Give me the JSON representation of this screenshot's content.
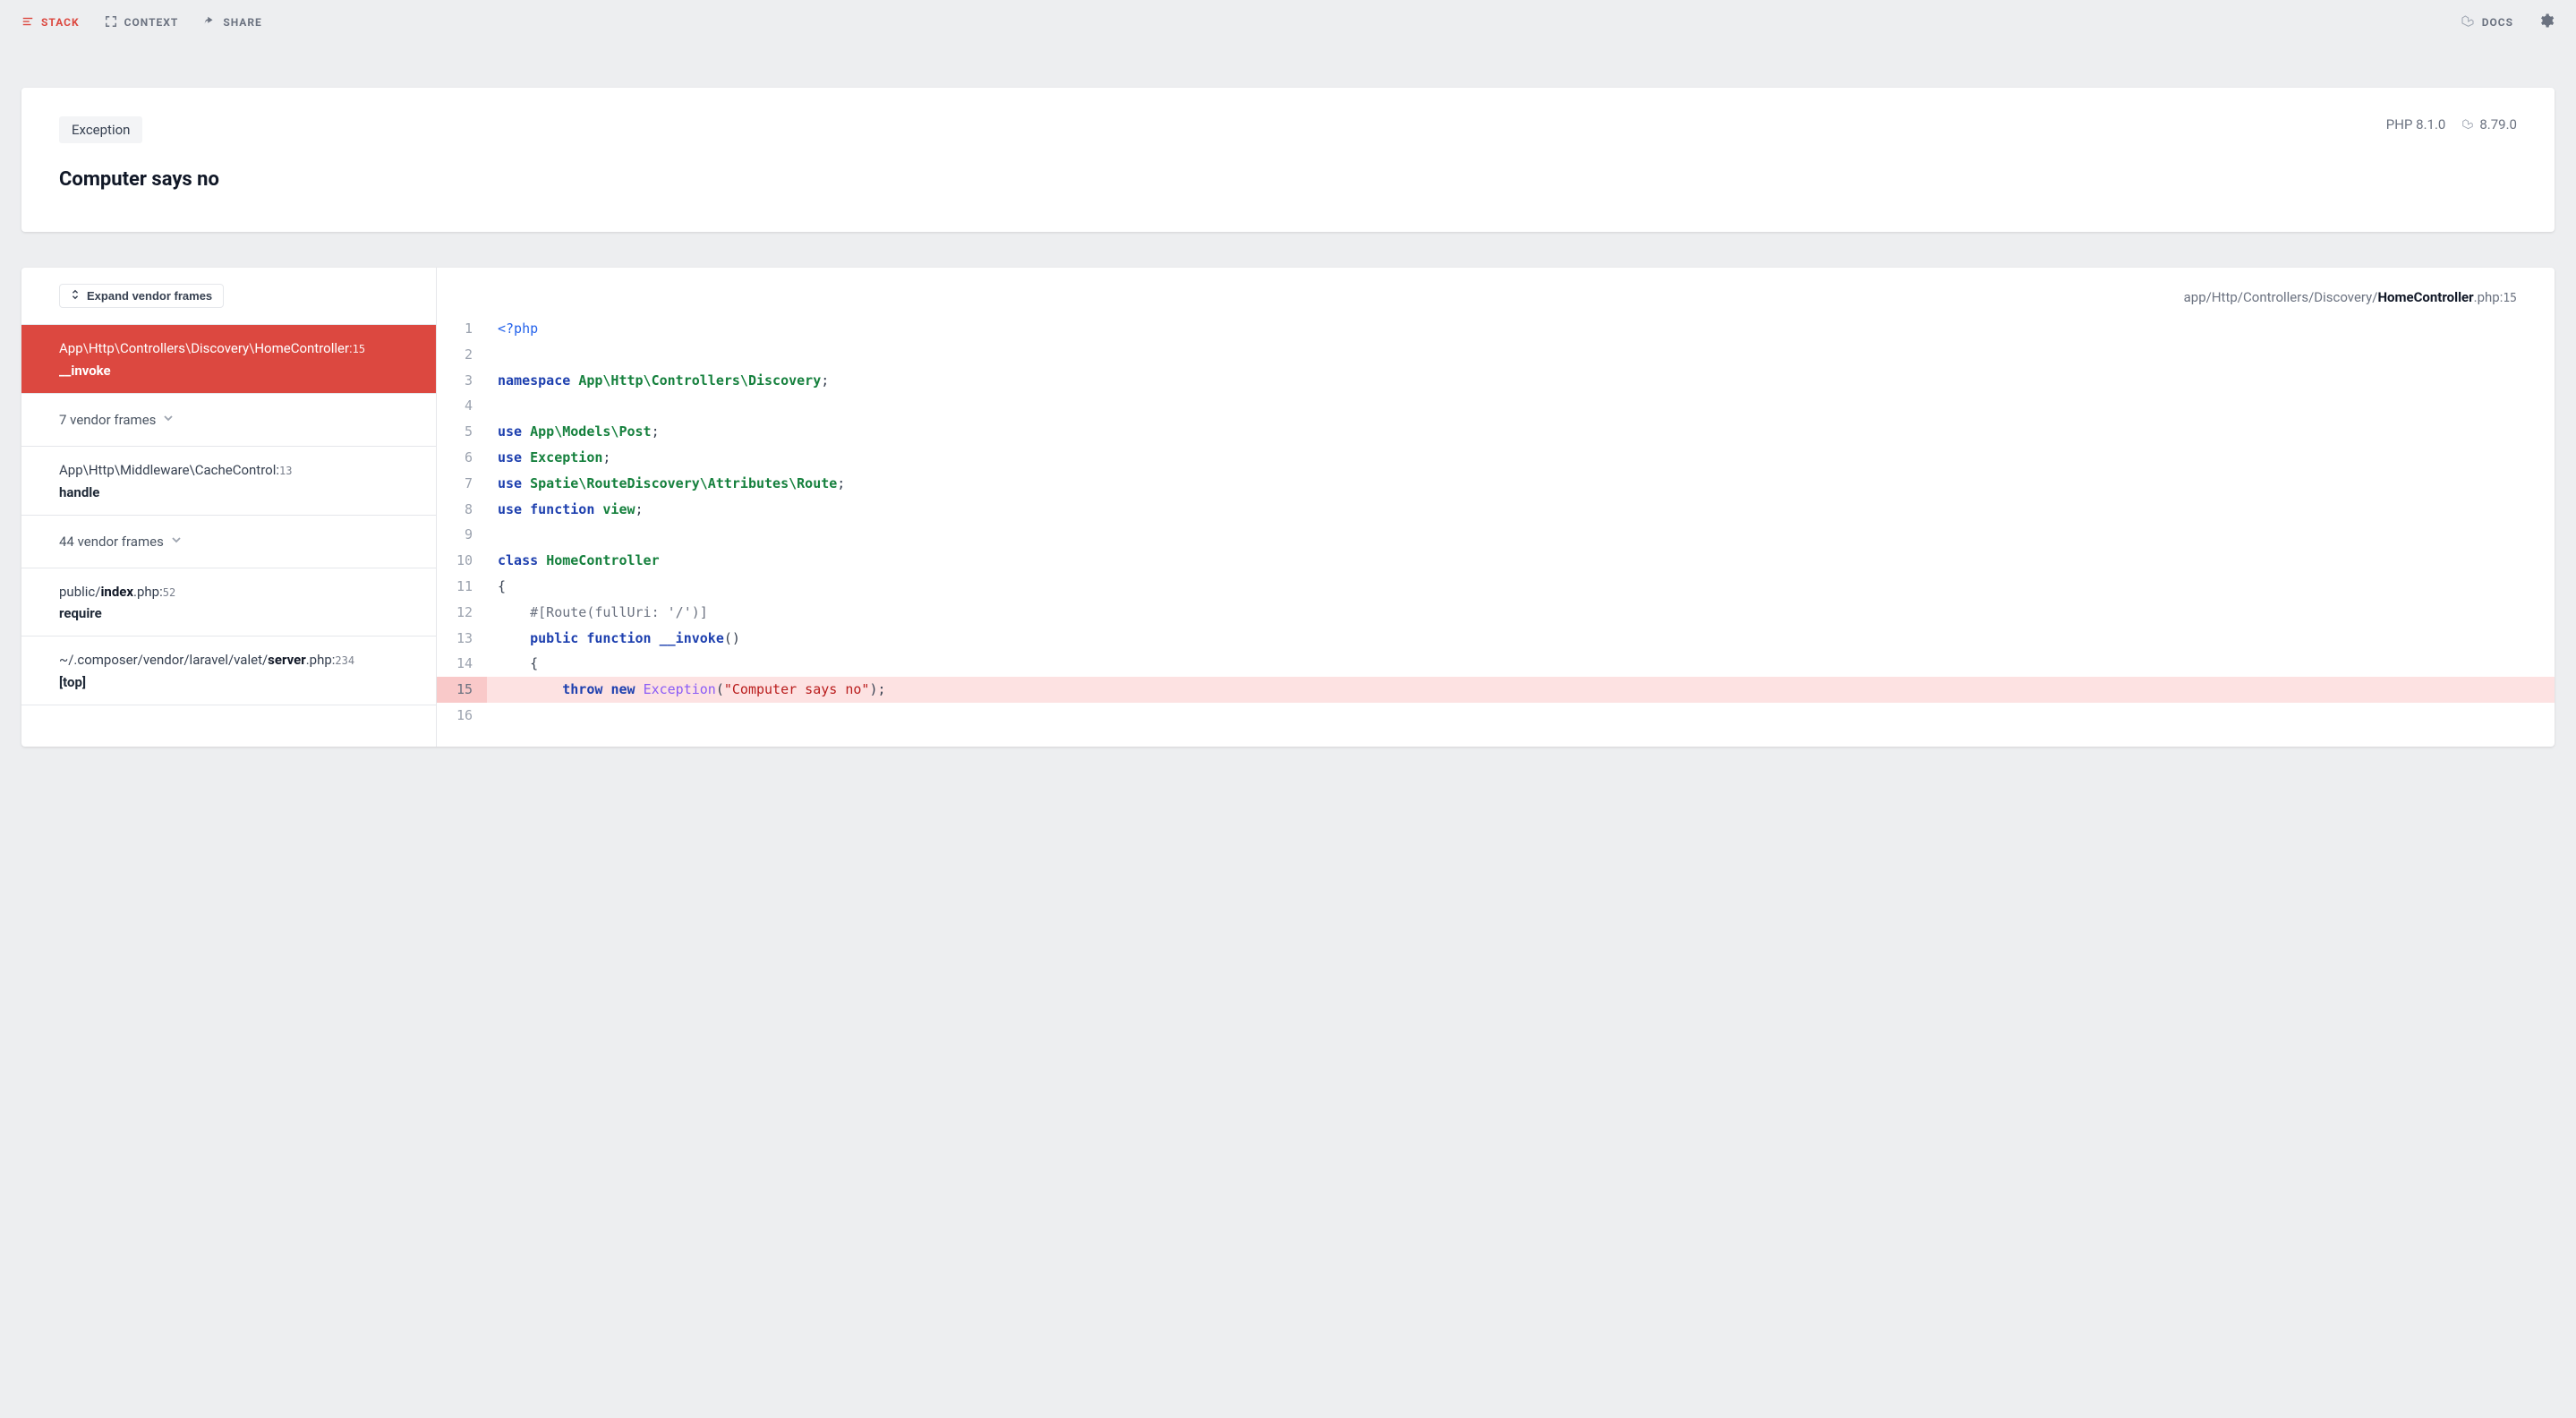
{
  "nav": {
    "stack": "STACK",
    "context": "CONTEXT",
    "share": "SHARE",
    "docs": "DOCS"
  },
  "exception": {
    "badge": "Exception",
    "message": "Computer says no",
    "php_version": "PHP 8.1.0",
    "laravel_version": "8.79.0"
  },
  "sidebar": {
    "expand_label": "Expand vendor frames",
    "frames": [
      {
        "type": "active",
        "path_segments": [
          "App",
          "Http",
          "Controllers",
          "Discovery",
          "HomeController"
        ],
        "line": "15",
        "method": "__invoke"
      },
      {
        "type": "collapsed",
        "label": "7 vendor frames"
      },
      {
        "type": "frame",
        "path_segments": [
          "App",
          "Http",
          "Middleware",
          "CacheControl"
        ],
        "line": "13",
        "method": "handle"
      },
      {
        "type": "collapsed",
        "label": "44 vendor frames"
      },
      {
        "type": "frame",
        "pre": "public/",
        "strong": "index",
        "post": ".php",
        "line": "52",
        "method": "require"
      },
      {
        "type": "frame",
        "pre": "~/.composer/vendor/laravel/valet/",
        "strong": "server",
        "post": ".php",
        "line": "234",
        "method": "[top]"
      }
    ]
  },
  "breadcrumb": {
    "segments": [
      "app",
      "Http",
      "Controllers",
      "Discovery"
    ],
    "file_strong": "HomeController",
    "file_ext": ".php",
    "line": "15"
  },
  "code": {
    "highlight_line": 15,
    "lines": [
      {
        "n": 1,
        "tokens": [
          {
            "c": "tok-tag",
            "t": "<?php"
          }
        ]
      },
      {
        "n": 2,
        "tokens": []
      },
      {
        "n": 3,
        "tokens": [
          {
            "c": "tok-kw",
            "t": "namespace"
          },
          {
            "c": "tok-plain",
            "t": " "
          },
          {
            "c": "tok-ns",
            "t": "App\\Http\\Controllers\\Discovery"
          },
          {
            "c": "tok-punc",
            "t": ";"
          }
        ]
      },
      {
        "n": 4,
        "tokens": []
      },
      {
        "n": 5,
        "tokens": [
          {
            "c": "tok-kw",
            "t": "use"
          },
          {
            "c": "tok-plain",
            "t": " "
          },
          {
            "c": "tok-ns",
            "t": "App\\Models\\Post"
          },
          {
            "c": "tok-punc",
            "t": ";"
          }
        ]
      },
      {
        "n": 6,
        "tokens": [
          {
            "c": "tok-kw",
            "t": "use"
          },
          {
            "c": "tok-plain",
            "t": " "
          },
          {
            "c": "tok-ns",
            "t": "Exception"
          },
          {
            "c": "tok-punc",
            "t": ";"
          }
        ]
      },
      {
        "n": 7,
        "tokens": [
          {
            "c": "tok-kw",
            "t": "use"
          },
          {
            "c": "tok-plain",
            "t": " "
          },
          {
            "c": "tok-ns",
            "t": "Spatie\\RouteDiscovery\\Attributes\\Route"
          },
          {
            "c": "tok-punc",
            "t": ";"
          }
        ]
      },
      {
        "n": 8,
        "tokens": [
          {
            "c": "tok-kw",
            "t": "use"
          },
          {
            "c": "tok-plain",
            "t": " "
          },
          {
            "c": "tok-kw",
            "t": "function"
          },
          {
            "c": "tok-plain",
            "t": " "
          },
          {
            "c": "tok-ns",
            "t": "view"
          },
          {
            "c": "tok-punc",
            "t": ";"
          }
        ]
      },
      {
        "n": 9,
        "tokens": []
      },
      {
        "n": 10,
        "tokens": [
          {
            "c": "tok-kw",
            "t": "class"
          },
          {
            "c": "tok-plain",
            "t": " "
          },
          {
            "c": "tok-cls",
            "t": "HomeController"
          }
        ]
      },
      {
        "n": 11,
        "tokens": [
          {
            "c": "tok-punc",
            "t": "{"
          }
        ]
      },
      {
        "n": 12,
        "tokens": [
          {
            "c": "tok-plain",
            "t": "    "
          },
          {
            "c": "tok-cm",
            "t": "#[Route(fullUri: '/')]"
          }
        ]
      },
      {
        "n": 13,
        "tokens": [
          {
            "c": "tok-plain",
            "t": "    "
          },
          {
            "c": "tok-kw",
            "t": "public"
          },
          {
            "c": "tok-plain",
            "t": " "
          },
          {
            "c": "tok-kw",
            "t": "function"
          },
          {
            "c": "tok-plain",
            "t": " "
          },
          {
            "c": "tok-fn",
            "t": "__invoke"
          },
          {
            "c": "tok-punc",
            "t": "()"
          }
        ]
      },
      {
        "n": 14,
        "tokens": [
          {
            "c": "tok-plain",
            "t": "    "
          },
          {
            "c": "tok-punc",
            "t": "{"
          }
        ]
      },
      {
        "n": 15,
        "tokens": [
          {
            "c": "tok-plain",
            "t": "        "
          },
          {
            "c": "tok-kw",
            "t": "throw"
          },
          {
            "c": "tok-plain",
            "t": " "
          },
          {
            "c": "tok-new",
            "t": "new"
          },
          {
            "c": "tok-plain",
            "t": " "
          },
          {
            "c": "tok-exc",
            "t": "Exception"
          },
          {
            "c": "tok-punc",
            "t": "("
          },
          {
            "c": "tok-str",
            "t": "\"Computer says no\""
          },
          {
            "c": "tok-punc",
            "t": ");"
          }
        ]
      },
      {
        "n": 16,
        "tokens": []
      }
    ]
  }
}
